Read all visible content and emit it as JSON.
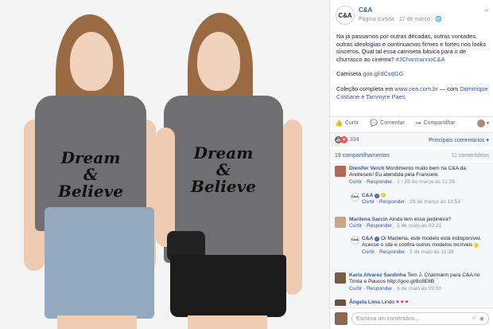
{
  "photo": {
    "left_shirt_lines": [
      "Dream",
      "&",
      "Believe"
    ],
    "right_shirt_lines": [
      "Dream",
      "&",
      "Believe"
    ]
  },
  "post": {
    "page_logo": "C&A",
    "page_name": "C&A",
    "meta": "Página curtida · 27 de março · 🌐",
    "paragraph1": "Na já passamos por outras décadas, outras vontades, outras ideologias e continuamos firmes e fortes nos looks sinceros. Qual tal essa camiseta básica para ir de churrasco ao cinema? ",
    "hashtag": "#JCharmannoC&A",
    "shirt_label": "Camiseta ",
    "shirt_link": "goo.gl/dCsqGG",
    "collection_label": "Coleção completa em ",
    "collection_link": "www.cea.com.br",
    "collection_with": " — com ",
    "collection_people": "Dominique Cristiane e Tammyre Paes"
  },
  "actions": {
    "like": "Curtir",
    "comment": "Comentar",
    "share": "Compartilhar"
  },
  "reactions": {
    "count": "334",
    "recent": "Principais comentários ▾"
  },
  "shares": {
    "label": "19 compartilhamentos",
    "comments": "11 comentários"
  },
  "comments": [
    {
      "name": "Dienifer Verch",
      "text": " Mordimento muito bem na C&A da Andreceis! Eu atendida pela Francielo.",
      "meta_actions": "Curtir · Responder",
      "meta_extra": " · 1 · 28 de março às 11:26"
    },
    {
      "name": "C&A",
      "text": " ",
      "meta_actions": "Curtir · Responder",
      "meta_extra": " · 28 de março às 13:53"
    },
    {
      "name": "Marilena Sarcin",
      "text": " Ainda tem essa jardineira?",
      "meta_actions": "Curtir · Responder",
      "meta_extra": " · 5 de maio às 03:21"
    },
    {
      "name": "C&A",
      "text": " Oi Marilena, este modelo está indisponível. Acesse o site e confira outros modelos incríveis ",
      "meta_actions": "Curtir · Responder",
      "meta_extra": " · 5 de maio às 11:39"
    },
    {
      "name": "Karla Alvarez Sardinha",
      "text": " Tem J. Charmann para C&A no Trinta e Poucos http://goo.gl/8c8E8B",
      "meta_actions": "Curtir · Responder",
      "meta_extra": " · 6 de maio às 09:00"
    },
    {
      "name": "Ângela Lima",
      "text": " Lindo ",
      "meta_actions": "",
      "meta_extra": ""
    }
  ],
  "comment_box": {
    "placeholder": "Escreva um comentário..."
  },
  "colors": {
    "link": "#365899",
    "muted": "#90949c",
    "like_blue": "#4267b2",
    "love_red": "#f25268"
  }
}
